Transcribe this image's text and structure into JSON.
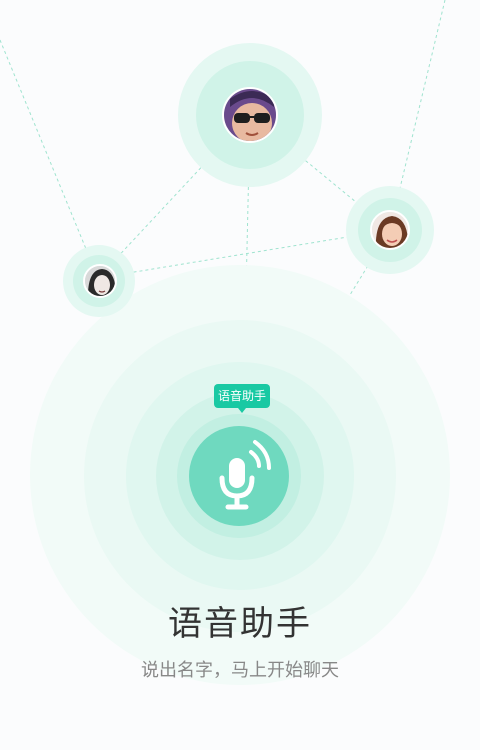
{
  "assistant": {
    "badge_label": "语音助手",
    "title": "语音助手",
    "subtitle": "说出名字，马上开始聊天"
  },
  "colors": {
    "accent": "#19c9a3",
    "mic_button": "#6fd9bf",
    "ring_light": "#eefaf6",
    "ring_mid": "#dcf6ee"
  },
  "icons": {
    "mic": "microphone-icon",
    "waves": "sound-waves-icon"
  },
  "contacts": [
    {
      "id": "contact-top"
    },
    {
      "id": "contact-right"
    },
    {
      "id": "contact-left"
    }
  ]
}
